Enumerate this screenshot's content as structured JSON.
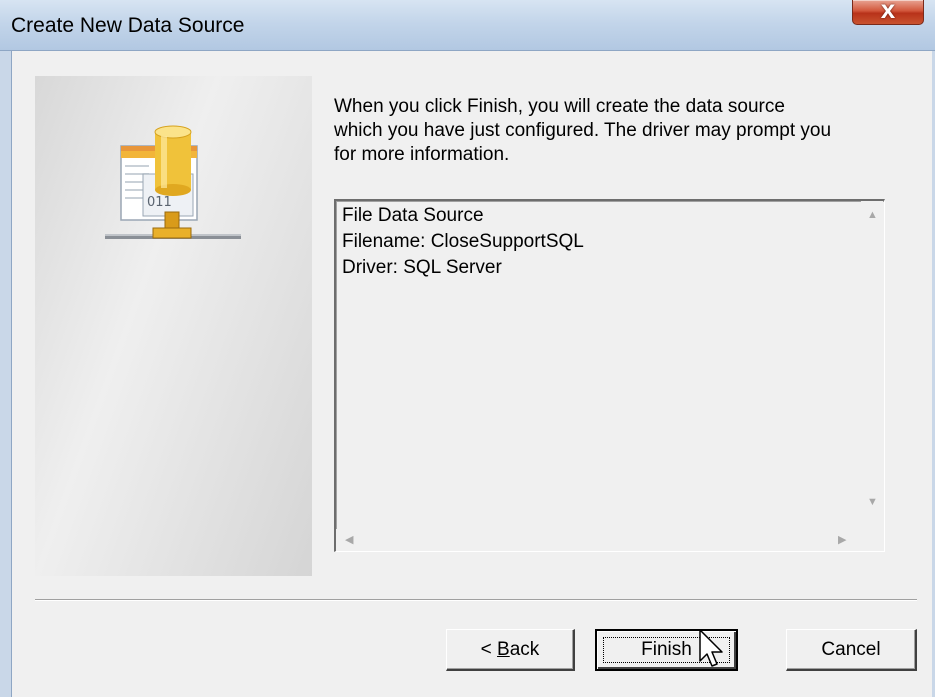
{
  "window": {
    "title": "Create New Data Source",
    "close_label": "x"
  },
  "wizard": {
    "description": "When you click Finish, you will create the data source\nwhich you have just configured.  The driver may prompt you\nfor more information.",
    "summary_lines": [
      "File Data Source",
      "Filename:  CloseSupportSQL",
      "Driver:  SQL Server"
    ]
  },
  "buttons": {
    "back_prefix": "< ",
    "back_mnemonic": "B",
    "back_rest": "ack",
    "finish": "Finish",
    "cancel": "Cancel"
  },
  "scrollbar": {
    "up_arrow": "▲",
    "down_arrow": "▼",
    "left_arrow": "◀",
    "right_arrow": "▶"
  }
}
